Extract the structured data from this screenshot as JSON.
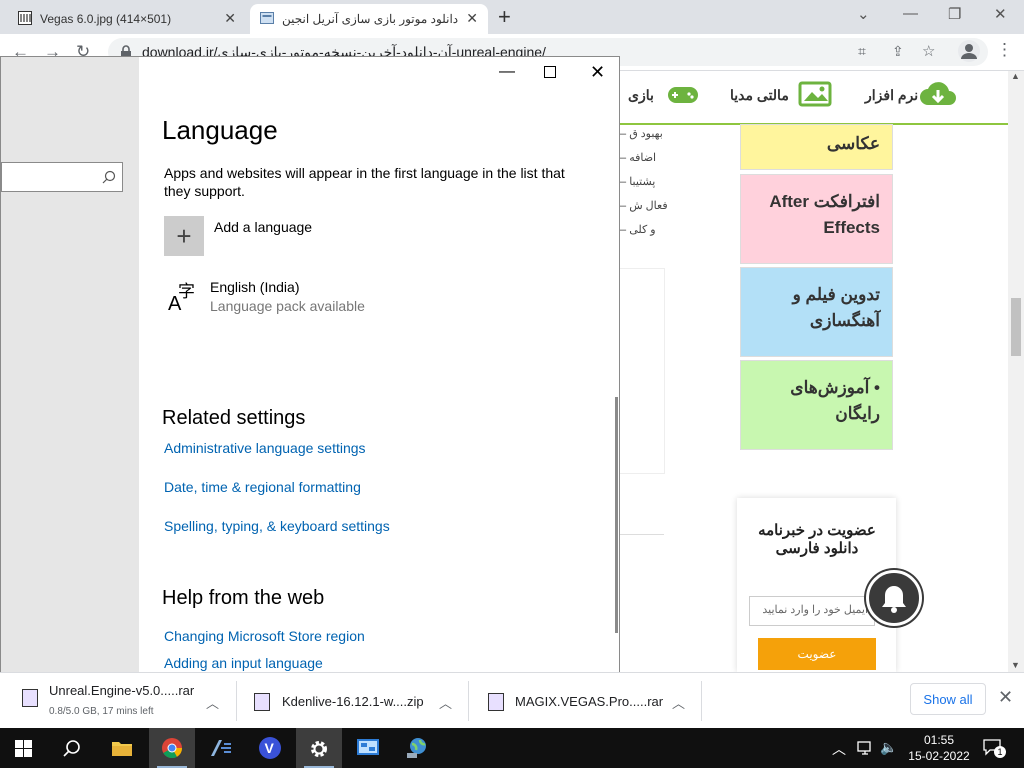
{
  "browser": {
    "tabs": [
      {
        "title": "Vegas 6.0.jpg (414×501)"
      },
      {
        "title": "دانلود موتور بازی سازی آنریل انجین"
      }
    ],
    "new_tab": "+",
    "url": "download.ir/آن-دانلود-آخرین-نسخه-موتور-بازی-سازی-unreal-engine/"
  },
  "site": {
    "menu": [
      "بازی",
      "مالتی مدیا",
      "نرم افزار"
    ],
    "bullets": [
      "– بهبود ق",
      "– اضافه",
      "– پشتیبا",
      "– فعال ش",
      "– و کلی"
    ],
    "categories": [
      {
        "label": "افترافکت After Effects",
        "color": "#ffd1dc"
      },
      {
        "label": "تدوین فیلم و آهنگسازی",
        "color": "#b3e0f7"
      },
      {
        "label": "• آموزش‌های رایگان",
        "color": "#c8f7b0"
      }
    ],
    "top_cat_color": "#fff59d",
    "top_cat_label": "عکاسی",
    "newsletter": {
      "title": "عضویت در خبرنامه دانلود فارسی",
      "placeholder": "ایمیل خود را وارد نمایید",
      "button": "عضویت"
    }
  },
  "settings": {
    "title": "Language",
    "description": "Apps and websites will appear in the first language in the list that they support.",
    "add_language": "Add a language",
    "language_name": "English (India)",
    "language_status": "Language pack available",
    "related_heading": "Related settings",
    "related_links": [
      "Administrative language settings",
      "Date, time & regional formatting",
      "Spelling, typing, & keyboard settings"
    ],
    "help_heading": "Help from the web",
    "help_links": [
      "Changing Microsoft Store region",
      "Adding an input language"
    ]
  },
  "downloads": {
    "items": [
      {
        "name": "Unreal.Engine-v5.0.....rar",
        "progress": "0.8/5.0 GB, 17 mins left"
      },
      {
        "name": "Kdenlive-16.12.1-w....zip"
      },
      {
        "name": "MAGIX.VEGAS.Pro.....rar"
      }
    ],
    "show_all": "Show all"
  },
  "taskbar": {
    "time": "01:55",
    "date": "15-02-2022",
    "notification_count": "1"
  }
}
